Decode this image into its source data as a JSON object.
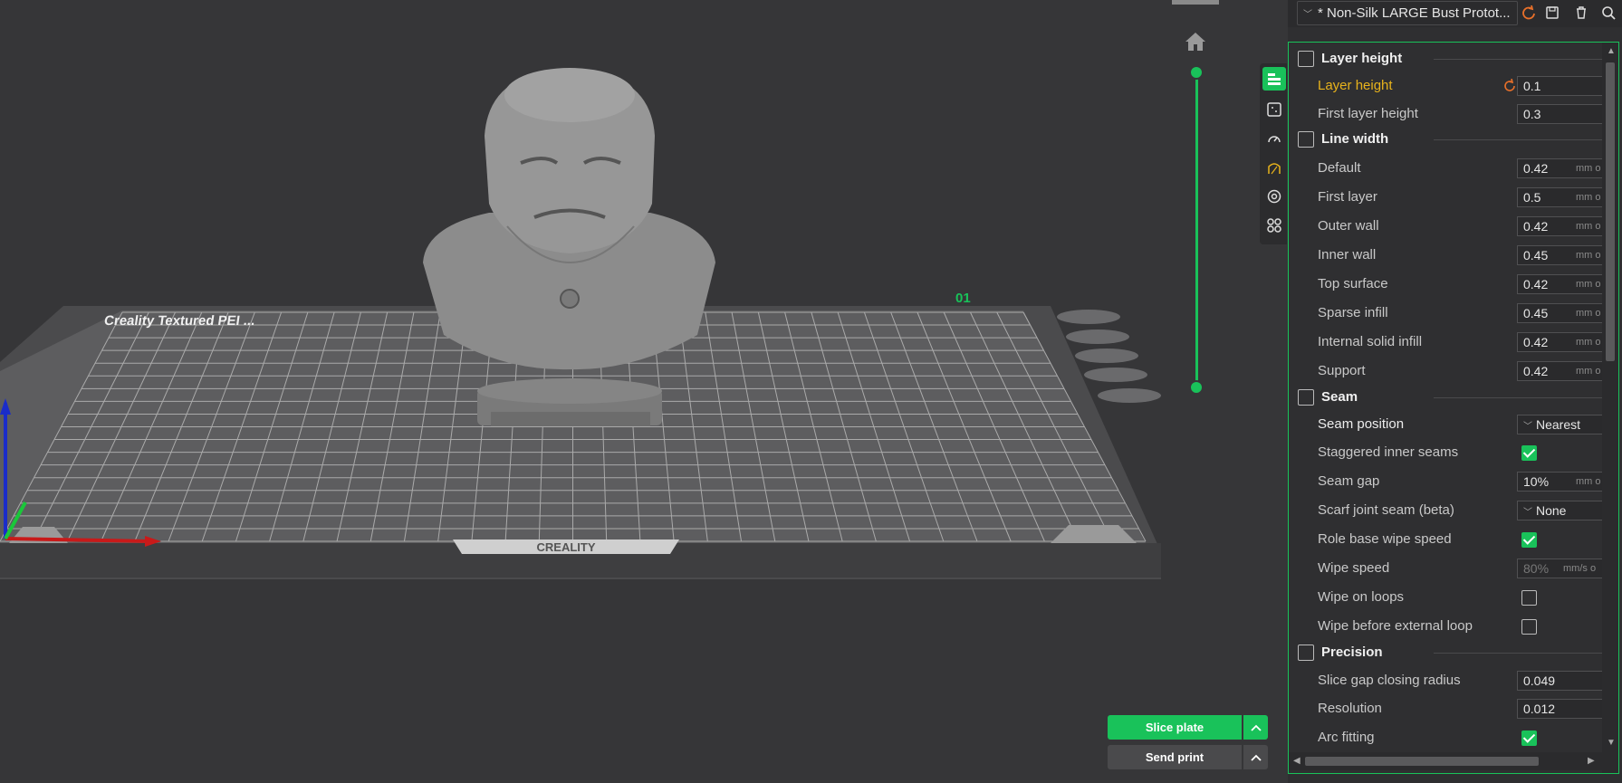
{
  "preset": {
    "name": "* Non-Silk LARGE Bust Protot...",
    "icons": [
      "reset-icon",
      "save-icon",
      "delete-icon",
      "search-icon"
    ]
  },
  "viewport": {
    "bed_logo": "CREALITY",
    "bed_label": "Creality Textured PEI ...",
    "plate_number": "01",
    "toolbar_icons": [
      "layer-height-icon",
      "seam-icon",
      "speed-icon",
      "support-icon",
      "multimaterial-icon",
      "others-icon"
    ]
  },
  "actions": {
    "slice_plate": "Slice plate",
    "send_print": "Send print"
  },
  "settings": {
    "sections": {
      "layer_height": "Layer height",
      "line_width": "Line width",
      "seam": "Seam",
      "precision": "Precision"
    },
    "layer_height": {
      "layer_height_label": "Layer height",
      "layer_height_value": "0.1",
      "first_layer_height_label": "First layer height",
      "first_layer_height_value": "0.3"
    },
    "line_width": {
      "unit": "mm o",
      "items": [
        {
          "label": "Default",
          "value": "0.42"
        },
        {
          "label": "First layer",
          "value": "0.5"
        },
        {
          "label": "Outer wall",
          "value": "0.42"
        },
        {
          "label": "Inner wall",
          "value": "0.45"
        },
        {
          "label": "Top surface",
          "value": "0.42"
        },
        {
          "label": "Sparse infill",
          "value": "0.45"
        },
        {
          "label": "Internal solid infill",
          "value": "0.42"
        },
        {
          "label": "Support",
          "value": "0.42"
        }
      ]
    },
    "seam": {
      "seam_position_label": "Seam position",
      "seam_position_value": "Nearest",
      "staggered_label": "Staggered inner seams",
      "staggered_checked": true,
      "seam_gap_label": "Seam gap",
      "seam_gap_value": "10%",
      "seam_gap_unit": "mm o",
      "scarf_label": "Scarf joint seam (beta)",
      "scarf_value": "None",
      "role_wipe_label": "Role base wipe speed",
      "role_wipe_checked": true,
      "wipe_speed_label": "Wipe speed",
      "wipe_speed_value": "80%",
      "wipe_speed_unit": "mm/s o",
      "wipe_loops_label": "Wipe on loops",
      "wipe_loops_checked": false,
      "wipe_before_label": "Wipe before external loop",
      "wipe_before_checked": false
    },
    "precision": {
      "slice_gap_label": "Slice gap closing radius",
      "slice_gap_value": "0.049",
      "resolution_label": "Resolution",
      "resolution_value": "0.012",
      "arc_label": "Arc fitting",
      "arc_checked": true
    }
  },
  "colors": {
    "accent": "#19c25a",
    "changed": "#e8b31c",
    "reset": "#e8702a",
    "background": "#363638",
    "panel": "#2f2f31"
  }
}
